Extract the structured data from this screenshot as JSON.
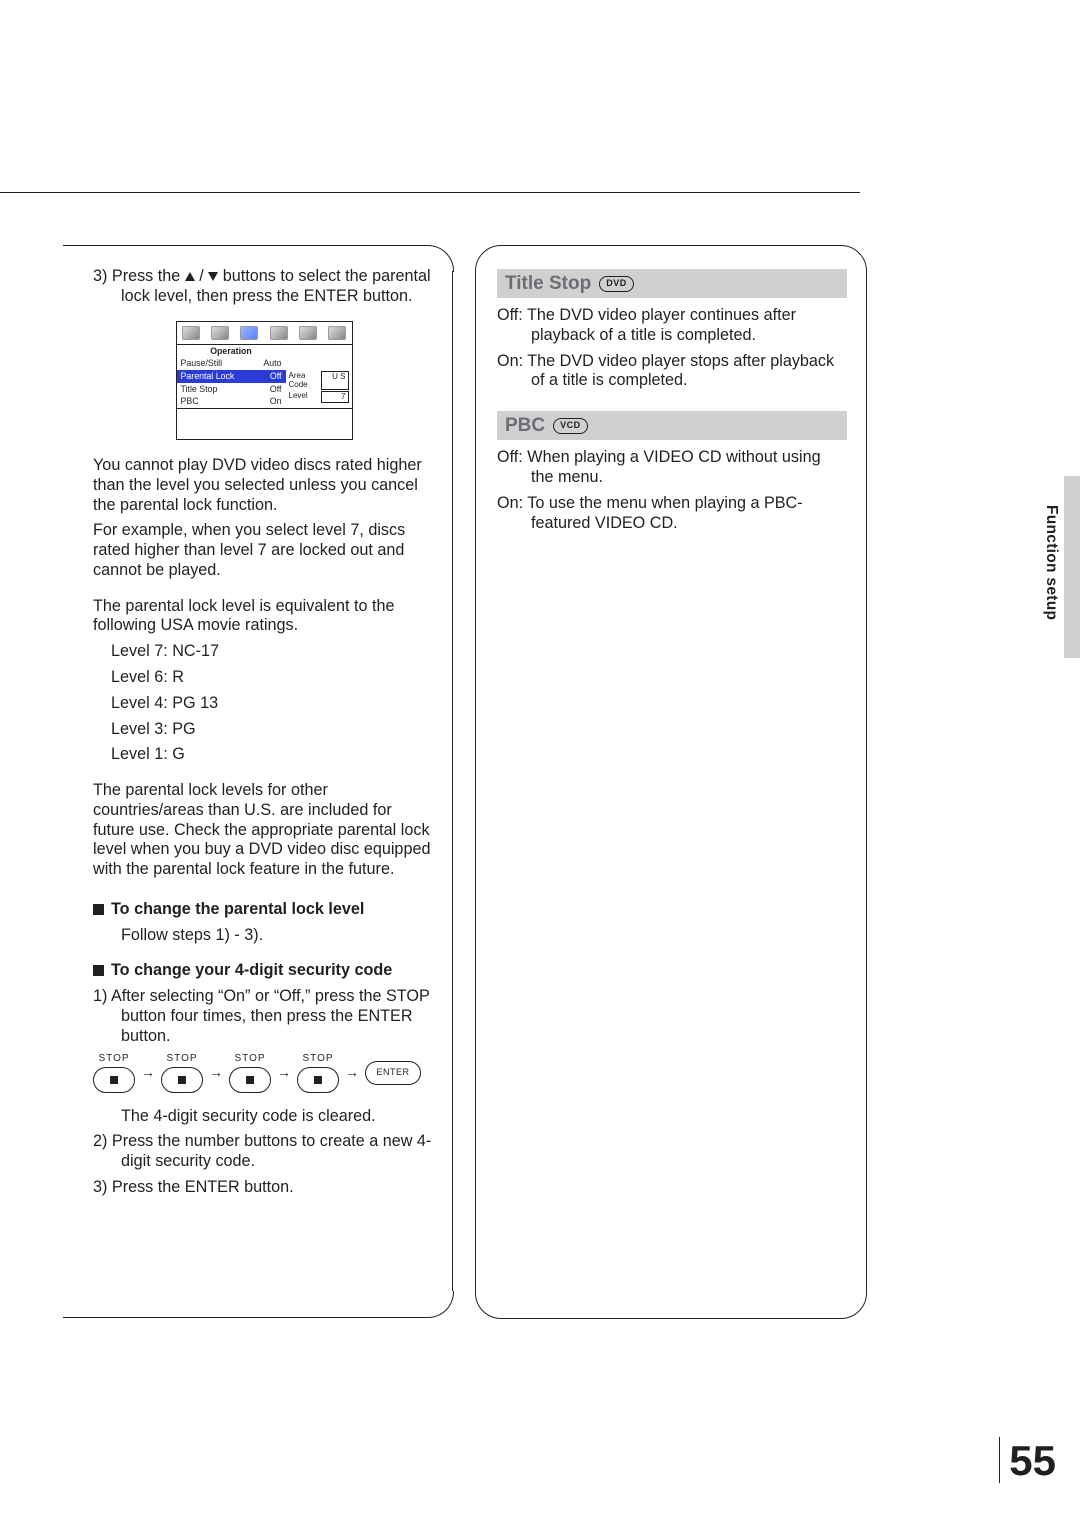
{
  "page_number": "55",
  "side_tab": "Function setup",
  "left": {
    "step3_a": "3)  Press the ",
    "step3_b": " buttons to select the parental lock level, then press the ENTER button.",
    "osd": {
      "header": "Operation",
      "rows": [
        {
          "label": "Pause/Still",
          "value": "Auto",
          "hi": false
        },
        {
          "label": "Parental Lock",
          "value": "Off",
          "hi": true
        },
        {
          "label": "Title Stop",
          "value": "Off",
          "hi": false
        },
        {
          "label": "PBC",
          "value": "On",
          "hi": false
        }
      ],
      "side": [
        {
          "label": "Area Code",
          "value": "U S"
        },
        {
          "label": "Level",
          "value": "7"
        }
      ]
    },
    "para1": "You cannot play DVD video discs rated higher than the level you selected unless you cancel the parental lock function.",
    "para2": "For example, when you select level 7, discs rated higher than level 7 are locked out and cannot be played.",
    "para3": "The parental lock level is equivalent to the following USA movie ratings.",
    "ratings": [
      "Level 7: NC-17",
      "Level 6: R",
      "Level 4: PG 13",
      "Level 3: PG",
      "Level 1: G"
    ],
    "para4": "The parental lock levels for other countries/areas than U.S. are included for future use. Check the appropriate parental lock level when you buy a DVD video disc equipped with the parental lock feature in the future.",
    "h_change_level": "To change the parental lock level",
    "change_level_body": "Follow steps 1) - 3).",
    "h_change_code": "To change your 4-digit security code",
    "code_step1": "1)  After selecting “On” or “Off,” press the STOP button four times, then press the ENTER button.",
    "seq_stop": "STOP",
    "seq_enter": "ENTER",
    "code_cleared": "The 4-digit security code is cleared.",
    "code_step2": "2)  Press the number buttons to create a new 4-digit security code.",
    "code_step3": "3)  Press the ENTER button."
  },
  "right": {
    "title_stop": {
      "heading": "Title Stop",
      "badge": "DVD",
      "off": "Off:  The DVD video player continues after playback of a title is completed.",
      "on": "On:  The DVD video player stops after playback of a title is completed."
    },
    "pbc": {
      "heading": "PBC",
      "badge": "VCD",
      "off": "Off:  When playing a VIDEO CD without using the menu.",
      "on": "On:  To use the menu when playing a PBC-featured VIDEO CD."
    }
  }
}
